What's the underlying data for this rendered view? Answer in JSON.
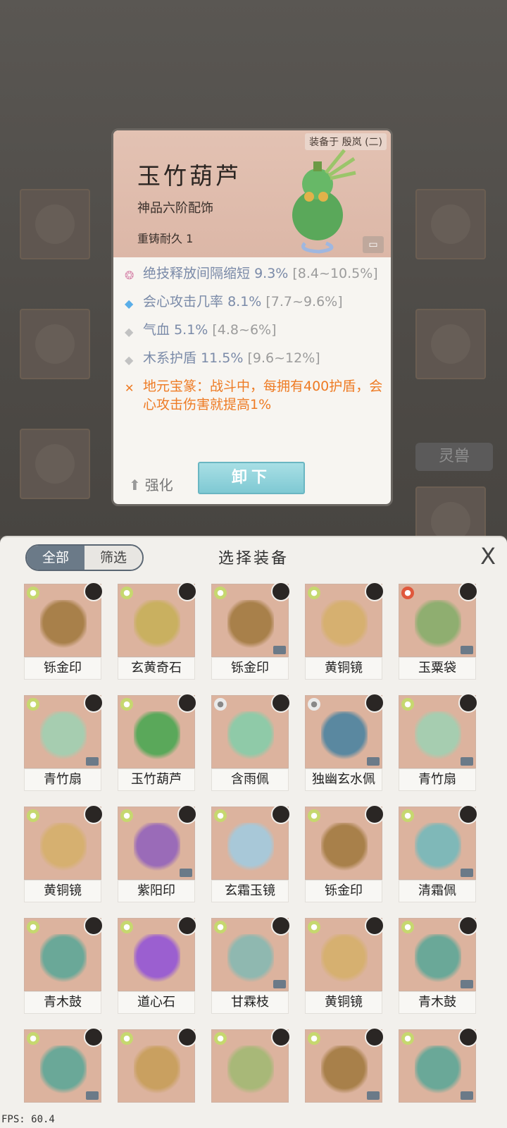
{
  "detail": {
    "equipped_by": "装备于 殷岚 (二)",
    "name": "玉竹葫芦",
    "grade": "神品六阶配饰",
    "recast": "重铸耐久 1",
    "stats": [
      {
        "icon": "skill-icon",
        "name": "绝技释放间隔缩短",
        "value": "9.3%",
        "range": "[8.4~10.5%]"
      },
      {
        "icon": "diamond-blue-icon",
        "name": "会心攻击几率",
        "value": "8.1%",
        "range": "[7.7~9.6%]"
      },
      {
        "icon": "diamond-gray-icon",
        "name": "气血",
        "value": "5.1%",
        "range": "[4.8~6%]"
      },
      {
        "icon": "diamond-gray-icon",
        "name": "木系护盾",
        "value": "11.5%",
        "range": "[9.6~12%]"
      }
    ],
    "special": "地元宝篆：战斗中，每拥有400护盾，会心攻击伤害就提高1%",
    "strengthen_label": "强化",
    "unequip_label": "卸下"
  },
  "background": {
    "spirit_label": "灵兽"
  },
  "panel": {
    "tabs": [
      "全部",
      "筛选"
    ],
    "title": "选择装备",
    "close_glyph": "X"
  },
  "items": [
    {
      "name": "铄金印",
      "elem": "wood"
    },
    {
      "name": "玄黄奇石",
      "elem": "wood"
    },
    {
      "name": "铄金印",
      "elem": "wood"
    },
    {
      "name": "黄铜镜",
      "elem": "wood"
    },
    {
      "name": "玉粟袋",
      "elem": "fire"
    },
    {
      "name": "青竹扇",
      "elem": "wood"
    },
    {
      "name": "玉竹葫芦",
      "elem": "wood"
    },
    {
      "name": "含雨佩",
      "elem": "white"
    },
    {
      "name": "独幽玄水佩",
      "elem": "white"
    },
    {
      "name": "青竹扇",
      "elem": "wood"
    },
    {
      "name": "黄铜镜",
      "elem": "wood"
    },
    {
      "name": "紫阳印",
      "elem": "wood"
    },
    {
      "name": "玄霜玉镜",
      "elem": "wood"
    },
    {
      "name": "铄金印",
      "elem": "wood"
    },
    {
      "name": "清霜佩",
      "elem": "wood"
    },
    {
      "name": "青木鼓",
      "elem": "wood"
    },
    {
      "name": "道心石",
      "elem": "wood"
    },
    {
      "name": "甘霖枝",
      "elem": "wood"
    },
    {
      "name": "黄铜镜",
      "elem": "wood"
    },
    {
      "name": "青木鼓",
      "elem": "wood"
    },
    {
      "name": "",
      "elem": "wood"
    },
    {
      "name": "",
      "elem": "wood"
    },
    {
      "name": "",
      "elem": "wood"
    },
    {
      "name": "",
      "elem": "wood"
    },
    {
      "name": "",
      "elem": "wood"
    }
  ],
  "fps": "FPS: 60.4",
  "colors": {
    "accent_teal": "#7fc9d3",
    "special_orange": "#ee7b24",
    "stat_blue": "#7a8aa8"
  }
}
